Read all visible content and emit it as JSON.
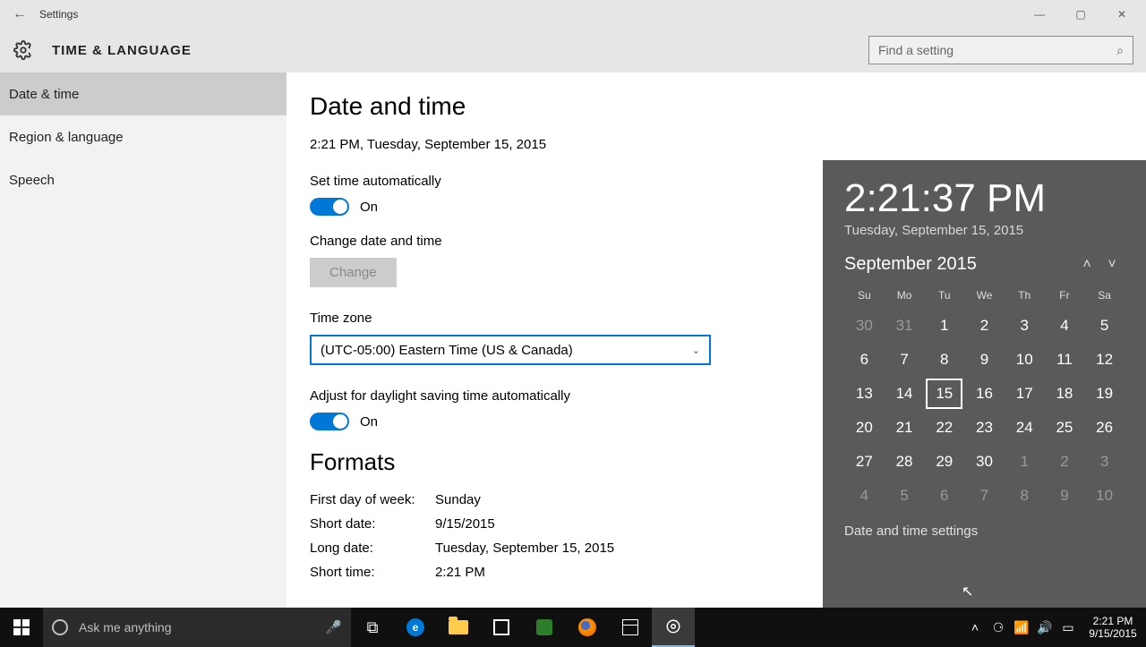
{
  "window": {
    "title": "Settings"
  },
  "header": {
    "title": "TIME & LANGUAGE",
    "search_placeholder": "Find a setting"
  },
  "sidebar": {
    "items": [
      {
        "label": "Date & time",
        "selected": true
      },
      {
        "label": "Region & language",
        "selected": false
      },
      {
        "label": "Speech",
        "selected": false
      }
    ]
  },
  "main": {
    "heading": "Date and time",
    "current": "2:21 PM, Tuesday, September 15, 2015",
    "auto_time_label": "Set time automatically",
    "auto_time_state": "On",
    "change_label": "Change date and time",
    "change_button": "Change",
    "tz_label": "Time zone",
    "tz_value": "(UTC-05:00) Eastern Time (US & Canada)",
    "dst_label": "Adjust for daylight saving time automatically",
    "dst_state": "On",
    "formats_heading": "Formats",
    "formats": [
      {
        "k": "First day of week:",
        "v": "Sunday"
      },
      {
        "k": "Short date:",
        "v": "9/15/2015"
      },
      {
        "k": "Long date:",
        "v": "Tuesday, September 15, 2015"
      },
      {
        "k": "Short time:",
        "v": "2:21 PM"
      }
    ]
  },
  "flyout": {
    "time": "2:21:37 PM",
    "date": "Tuesday, September 15, 2015",
    "month": "September 2015",
    "dow": [
      "Su",
      "Mo",
      "Tu",
      "We",
      "Th",
      "Fr",
      "Sa"
    ],
    "weeks": [
      [
        {
          "n": "30",
          "dim": true
        },
        {
          "n": "31",
          "dim": true
        },
        {
          "n": "1"
        },
        {
          "n": "2"
        },
        {
          "n": "3"
        },
        {
          "n": "4"
        },
        {
          "n": "5"
        }
      ],
      [
        {
          "n": "6"
        },
        {
          "n": "7"
        },
        {
          "n": "8"
        },
        {
          "n": "9"
        },
        {
          "n": "10"
        },
        {
          "n": "11"
        },
        {
          "n": "12"
        }
      ],
      [
        {
          "n": "13"
        },
        {
          "n": "14"
        },
        {
          "n": "15",
          "today": true
        },
        {
          "n": "16"
        },
        {
          "n": "17"
        },
        {
          "n": "18"
        },
        {
          "n": "19"
        }
      ],
      [
        {
          "n": "20"
        },
        {
          "n": "21"
        },
        {
          "n": "22"
        },
        {
          "n": "23"
        },
        {
          "n": "24"
        },
        {
          "n": "25"
        },
        {
          "n": "26"
        }
      ],
      [
        {
          "n": "27"
        },
        {
          "n": "28"
        },
        {
          "n": "29"
        },
        {
          "n": "30"
        },
        {
          "n": "1",
          "dim": true
        },
        {
          "n": "2",
          "dim": true
        },
        {
          "n": "3",
          "dim": true
        }
      ],
      [
        {
          "n": "4",
          "dim": true
        },
        {
          "n": "5",
          "dim": true
        },
        {
          "n": "6",
          "dim": true
        },
        {
          "n": "7",
          "dim": true
        },
        {
          "n": "8",
          "dim": true
        },
        {
          "n": "9",
          "dim": true
        },
        {
          "n": "10",
          "dim": true
        }
      ]
    ],
    "settings_link": "Date and time settings"
  },
  "taskbar": {
    "cortana_placeholder": "Ask me anything",
    "clock_time": "2:21 PM",
    "clock_date": "9/15/2015"
  }
}
